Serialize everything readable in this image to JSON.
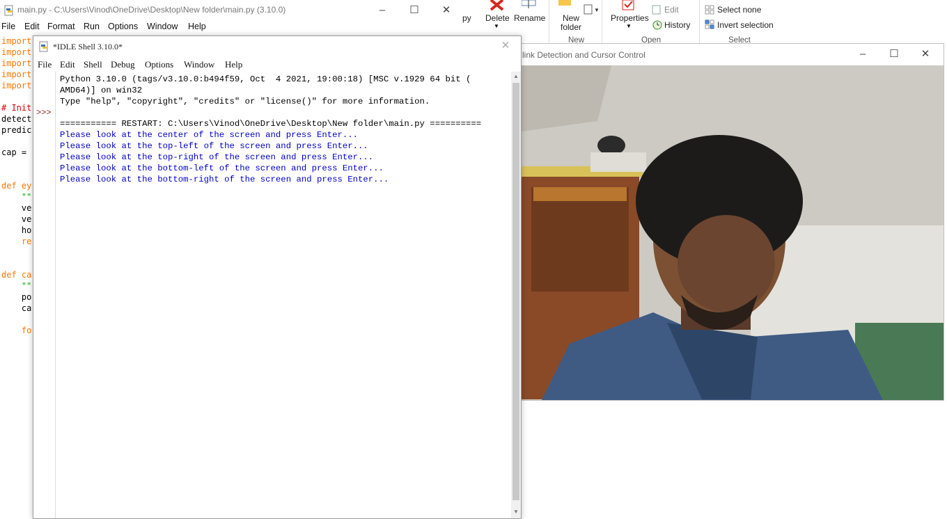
{
  "editor": {
    "title": "main.py - C:\\Users\\Vinod\\OneDrive\\Desktop\\New folder\\main.py (3.10.0)",
    "menu": [
      "File",
      "Edit",
      "Format",
      "Run",
      "Options",
      "Window",
      "Help"
    ],
    "code_lines": [
      {
        "text": "import",
        "color": "#ff7700"
      },
      {
        "text": "import",
        "color": "#ff7700"
      },
      {
        "text": "import",
        "color": "#ff7700"
      },
      {
        "text": "import",
        "color": "#ff7700"
      },
      {
        "text": "import",
        "color": "#ff7700"
      },
      {
        "text": "",
        "color": "#000000"
      },
      {
        "text": "# Init",
        "color": "#dd0000"
      },
      {
        "text": "detect",
        "color": "#000000"
      },
      {
        "text": "predic",
        "color": "#000000"
      },
      {
        "text": "",
        "color": "#000000"
      },
      {
        "text": "cap =",
        "color": "#000000"
      },
      {
        "text": "",
        "color": "#000000"
      },
      {
        "text": "",
        "color": "#000000"
      },
      {
        "text": "def ey",
        "color": "#ff7700"
      },
      {
        "text": "    \"\"",
        "color": "#00aa00"
      },
      {
        "text": "    ve",
        "color": "#000000"
      },
      {
        "text": "    ve",
        "color": "#000000"
      },
      {
        "text": "    ho",
        "color": "#000000"
      },
      {
        "text": "    re",
        "color": "#ff7700"
      },
      {
        "text": "",
        "color": "#000000"
      },
      {
        "text": "",
        "color": "#000000"
      },
      {
        "text": "def ca",
        "color": "#ff7700"
      },
      {
        "text": "    \"\"",
        "color": "#00aa00"
      },
      {
        "text": "    po",
        "color": "#000000"
      },
      {
        "text": "    ca",
        "color": "#000000"
      },
      {
        "text": "",
        "color": "#000000"
      },
      {
        "text": "    fo",
        "color": "#ff7700"
      }
    ]
  },
  "ribbon": {
    "copy_partial": "py",
    "delete": "Delete",
    "rename": "Rename",
    "new_folder": "New folder",
    "properties": "Properties",
    "edit": "Edit",
    "history": "History",
    "select_none": "Select none",
    "invert_selection": "Invert selection",
    "group_new": "New",
    "group_open": "Open",
    "group_select": "Select"
  },
  "camera": {
    "title": "link Detection and Cursor Control"
  },
  "shell": {
    "title": "*IDLE Shell 3.10.0*",
    "menu": [
      "File",
      "Edit",
      "Shell",
      "Debug",
      "Options",
      "Window",
      "Help"
    ],
    "prompt": ">>>",
    "lines": [
      {
        "text": "Python 3.10.0 (tags/v3.10.0:b494f59, Oct  4 2021, 19:00:18) [MSC v.1929 64 bit (",
        "kind": "normal"
      },
      {
        "text": "AMD64)] on win32",
        "kind": "normal"
      },
      {
        "text": "Type \"help\", \"copyright\", \"credits\" or \"license()\" for more information.",
        "kind": "normal"
      },
      {
        "text": "",
        "kind": "normal"
      },
      {
        "text": "=========== RESTART: C:\\Users\\Vinod\\OneDrive\\Desktop\\New folder\\main.py ==========",
        "kind": "normal"
      },
      {
        "text": "Please look at the center of the screen and press Enter...",
        "kind": "blue"
      },
      {
        "text": "Please look at the top-left of the screen and press Enter...",
        "kind": "blue"
      },
      {
        "text": "Please look at the top-right of the screen and press Enter...",
        "kind": "blue"
      },
      {
        "text": "Please look at the bottom-left of the screen and press Enter...",
        "kind": "blue"
      },
      {
        "text": "Please look at the bottom-right of the screen and press Enter...",
        "kind": "blue"
      }
    ]
  }
}
